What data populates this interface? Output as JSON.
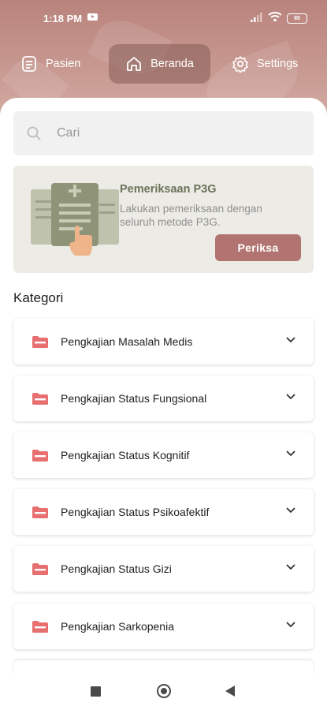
{
  "status": {
    "time": "1:18 PM",
    "battery": "85"
  },
  "tabs": [
    {
      "label": "Pasien",
      "icon": "document-icon"
    },
    {
      "label": "Beranda",
      "icon": "home-icon",
      "active": true
    },
    {
      "label": "Settings",
      "icon": "gear-icon"
    }
  ],
  "search": {
    "placeholder": "Cari",
    "value": ""
  },
  "promo": {
    "title": "Pemeriksaan P3G",
    "description": "Lakukan pemeriksaan dengan seluruh metode P3G.",
    "button_label": "Periksa"
  },
  "section_title": "Kategori",
  "categories": [
    {
      "label": "Pengkajian Masalah Medis"
    },
    {
      "label": "Pengkajian Status Fungsional"
    },
    {
      "label": "Pengkajian Status Kognitif"
    },
    {
      "label": "Pengkajian Status Psikoafektif"
    },
    {
      "label": "Pengkajian Status Gizi"
    },
    {
      "label": "Pengkajian Sarkopenia"
    }
  ],
  "colors": {
    "header": "#b9837c",
    "accent_button": "#b27470",
    "promo_bg": "#ecebe6",
    "promo_title": "#6d7258",
    "folder_icon": "#e76f6f"
  }
}
